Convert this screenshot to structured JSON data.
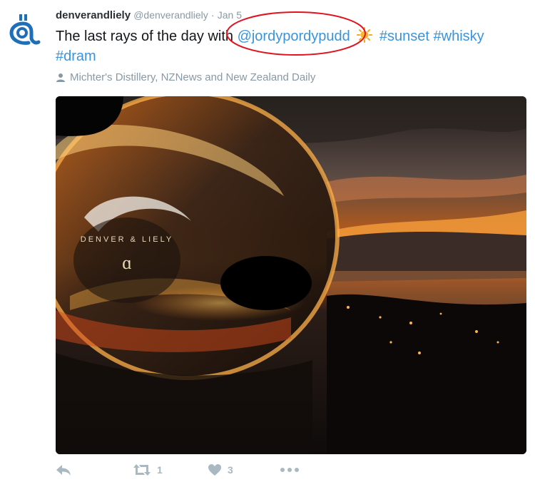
{
  "tweet": {
    "display_name": "denverandliely",
    "handle": "@denverandliely",
    "separator": "·",
    "date": "Jan 5",
    "text_prefix": "The last rays of the day with ",
    "mention": "@jordypordypudd",
    "hashtags": [
      "#sunset",
      "#whisky",
      "#dram"
    ],
    "tagged_users": "Michter's Distillery, NZNews and New Zealand Daily"
  },
  "media": {
    "bottle_lettering": "DENVER & LIELY"
  },
  "actions": {
    "reply_icon": "reply-icon",
    "retweet_icon": "retweet-icon",
    "retweet_count": "1",
    "like_icon": "heart-icon",
    "like_count": "3",
    "more_icon": "more-icon"
  },
  "colors": {
    "link": "#3b94d9",
    "annotation_circle": "#e0141e",
    "muted": "#8899a6",
    "action_icons": "#aab8c2",
    "brand_logo": "#1f6fb8"
  }
}
